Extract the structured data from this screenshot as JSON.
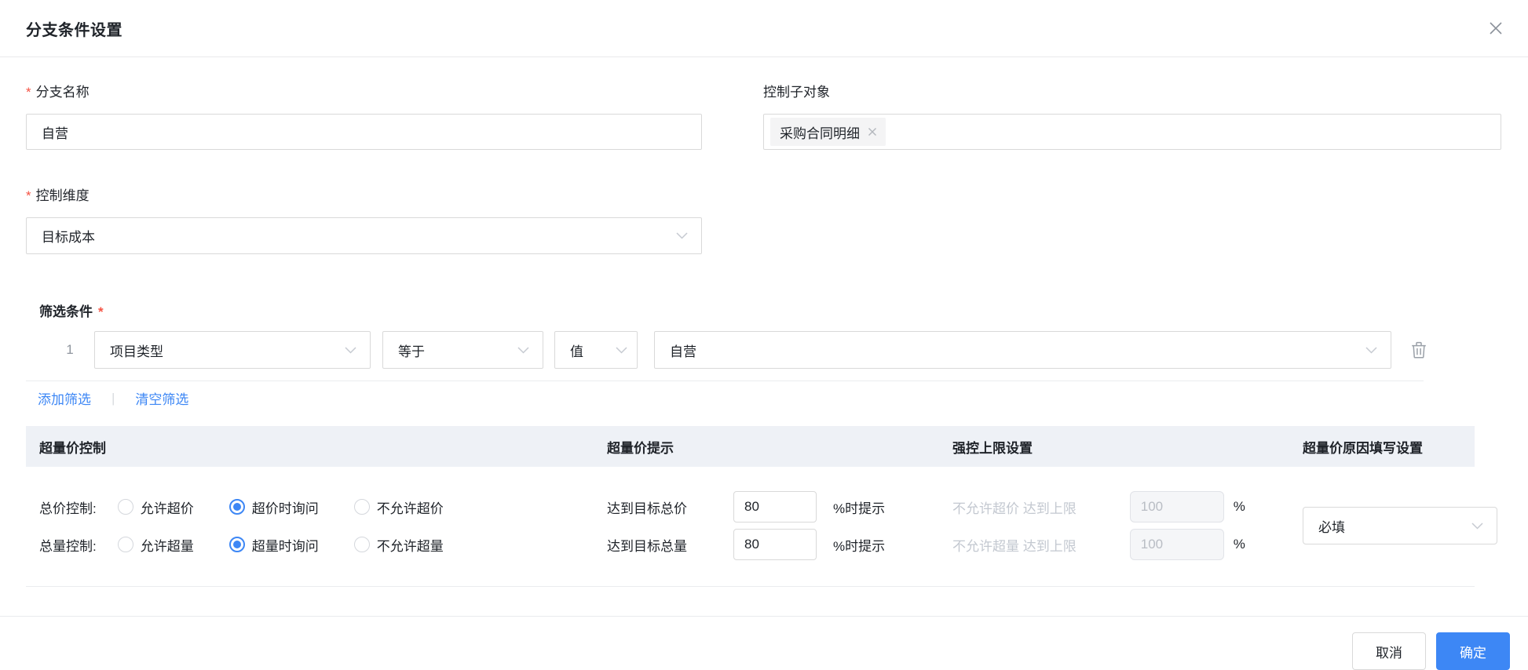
{
  "colors": {
    "accent_blue": "#3d87f5",
    "required_red": "#f55445",
    "link_blue": "#3d87f5",
    "table_header_bg": "#eef1f6",
    "disabled_text": "#b9bdc4"
  },
  "dialog": {
    "title": "分支条件设置",
    "required_marker": "*"
  },
  "form": {
    "branch_name": {
      "label": "分支名称",
      "value": "自营"
    },
    "control_sub_object": {
      "label": "控制子对象",
      "tag_label": "采购合同明细"
    },
    "control_dimension": {
      "label": "控制维度",
      "value": "目标成本"
    }
  },
  "filter": {
    "heading": "筛选条件",
    "row": {
      "index": "1",
      "field": "项目类型",
      "operator": "等于",
      "value_type": "值",
      "value": "自营"
    },
    "add_label": "添加筛选",
    "divider": "|",
    "clear_label": "清空筛选"
  },
  "table": {
    "headers": [
      "超量价控制",
      "超量价提示",
      "强控上限设置",
      "超量价原因填写设置"
    ],
    "rows": [
      {
        "label": "总价控制:",
        "options": [
          {
            "label": "允许超价",
            "checked": false
          },
          {
            "label": "超价时询问",
            "checked": true
          },
          {
            "label": "不允许超价",
            "checked": false
          }
        ],
        "reach_label": "达到目标总价",
        "reach_value": "80",
        "reach_suffix": "%时提示",
        "limit_label": "不允许超价 达到上限",
        "limit_value": "100",
        "limit_suffix": "%"
      },
      {
        "label": "总量控制:",
        "options": [
          {
            "label": "允许超量",
            "checked": false
          },
          {
            "label": "超量时询问",
            "checked": true
          },
          {
            "label": "不允许超量",
            "checked": false
          }
        ],
        "reach_label": "达到目标总量",
        "reach_value": "80",
        "reach_suffix": "%时提示",
        "limit_label": "不允许超量 达到上限",
        "limit_value": "100",
        "limit_suffix": "%"
      }
    ],
    "reason_value": "必填"
  },
  "footer": {
    "cancel": "取消",
    "confirm": "确定"
  }
}
